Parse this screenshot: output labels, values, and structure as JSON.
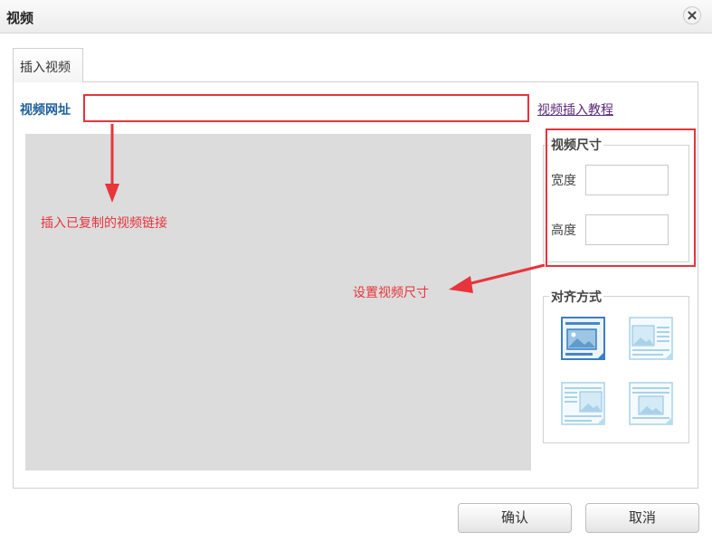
{
  "dialog": {
    "title": "视频"
  },
  "tabs": [
    {
      "label": "插入视频"
    }
  ],
  "url": {
    "label": "视频网址",
    "value": "",
    "placeholder": ""
  },
  "tutorial_link": "视频插入教程",
  "size": {
    "legend": "视频尺寸",
    "width_label": "宽度",
    "height_label": "高度",
    "width_value": "",
    "height_value": ""
  },
  "align": {
    "legend": "对齐方式",
    "options": [
      {
        "name": "none",
        "icon": "align-none-icon",
        "selected": true
      },
      {
        "name": "left",
        "icon": "align-left-icon",
        "selected": false
      },
      {
        "name": "right",
        "icon": "align-right-icon",
        "selected": false
      },
      {
        "name": "center",
        "icon": "align-center-icon",
        "selected": false
      }
    ]
  },
  "annotations": {
    "paste_link": "插入已复制的视频链接",
    "set_size": "设置视频尺寸"
  },
  "buttons": {
    "ok": "确认",
    "cancel": "取消"
  },
  "colors": {
    "annotation": "#e8343b",
    "label": "#1f5f9c",
    "preview_bg": "#dcdcdc"
  }
}
